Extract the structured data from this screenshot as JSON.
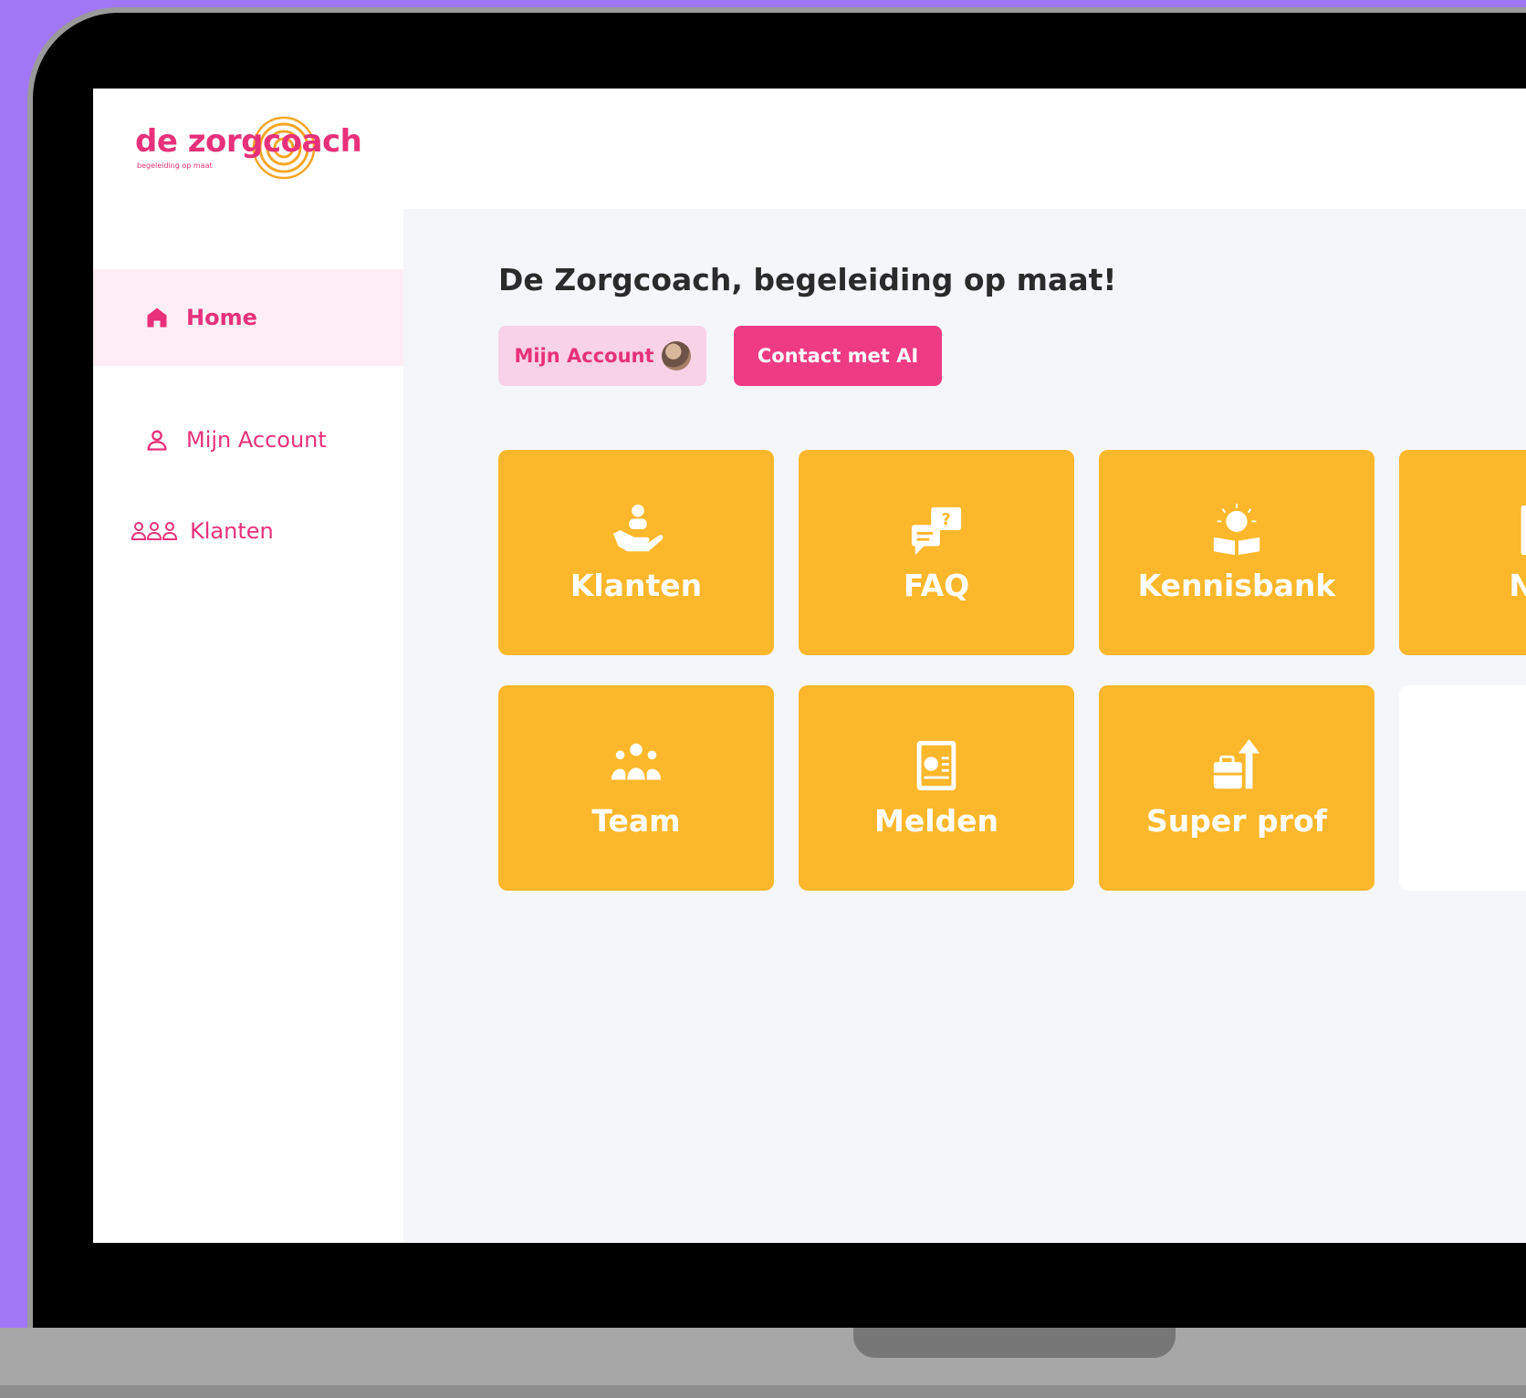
{
  "logo": {
    "name": "de zorgcoach",
    "tagline": "begeleiding op maat"
  },
  "sidebar": {
    "items": [
      {
        "label": "Home",
        "icon": "home-icon",
        "active": true
      },
      {
        "label": "Mijn Account",
        "icon": "user-icon",
        "active": false
      },
      {
        "label": "Klanten",
        "icon": "users-group-icon",
        "active": false
      }
    ]
  },
  "main": {
    "title": "De Zorgcoach, begeleiding  op maat!",
    "account_button": "Mijn Account",
    "contact_button": "Contact met AI",
    "tiles": [
      {
        "label": "Klanten",
        "icon": "hand-care-icon"
      },
      {
        "label": "FAQ",
        "icon": "chat-question-icon"
      },
      {
        "label": "Kennisbank",
        "icon": "book-idea-icon"
      },
      {
        "label": "Nie",
        "icon": "newspaper-icon"
      },
      {
        "label": "Team",
        "icon": "team-icon"
      },
      {
        "label": "Melden",
        "icon": "report-icon"
      },
      {
        "label": "Super prof",
        "icon": "briefcase-growth-icon"
      }
    ]
  },
  "colors": {
    "brand_pink": "#e8317a",
    "tile_yellow": "#fdb72b",
    "background_purple": "#a078f8",
    "content_bg": "#f5f6fa"
  }
}
